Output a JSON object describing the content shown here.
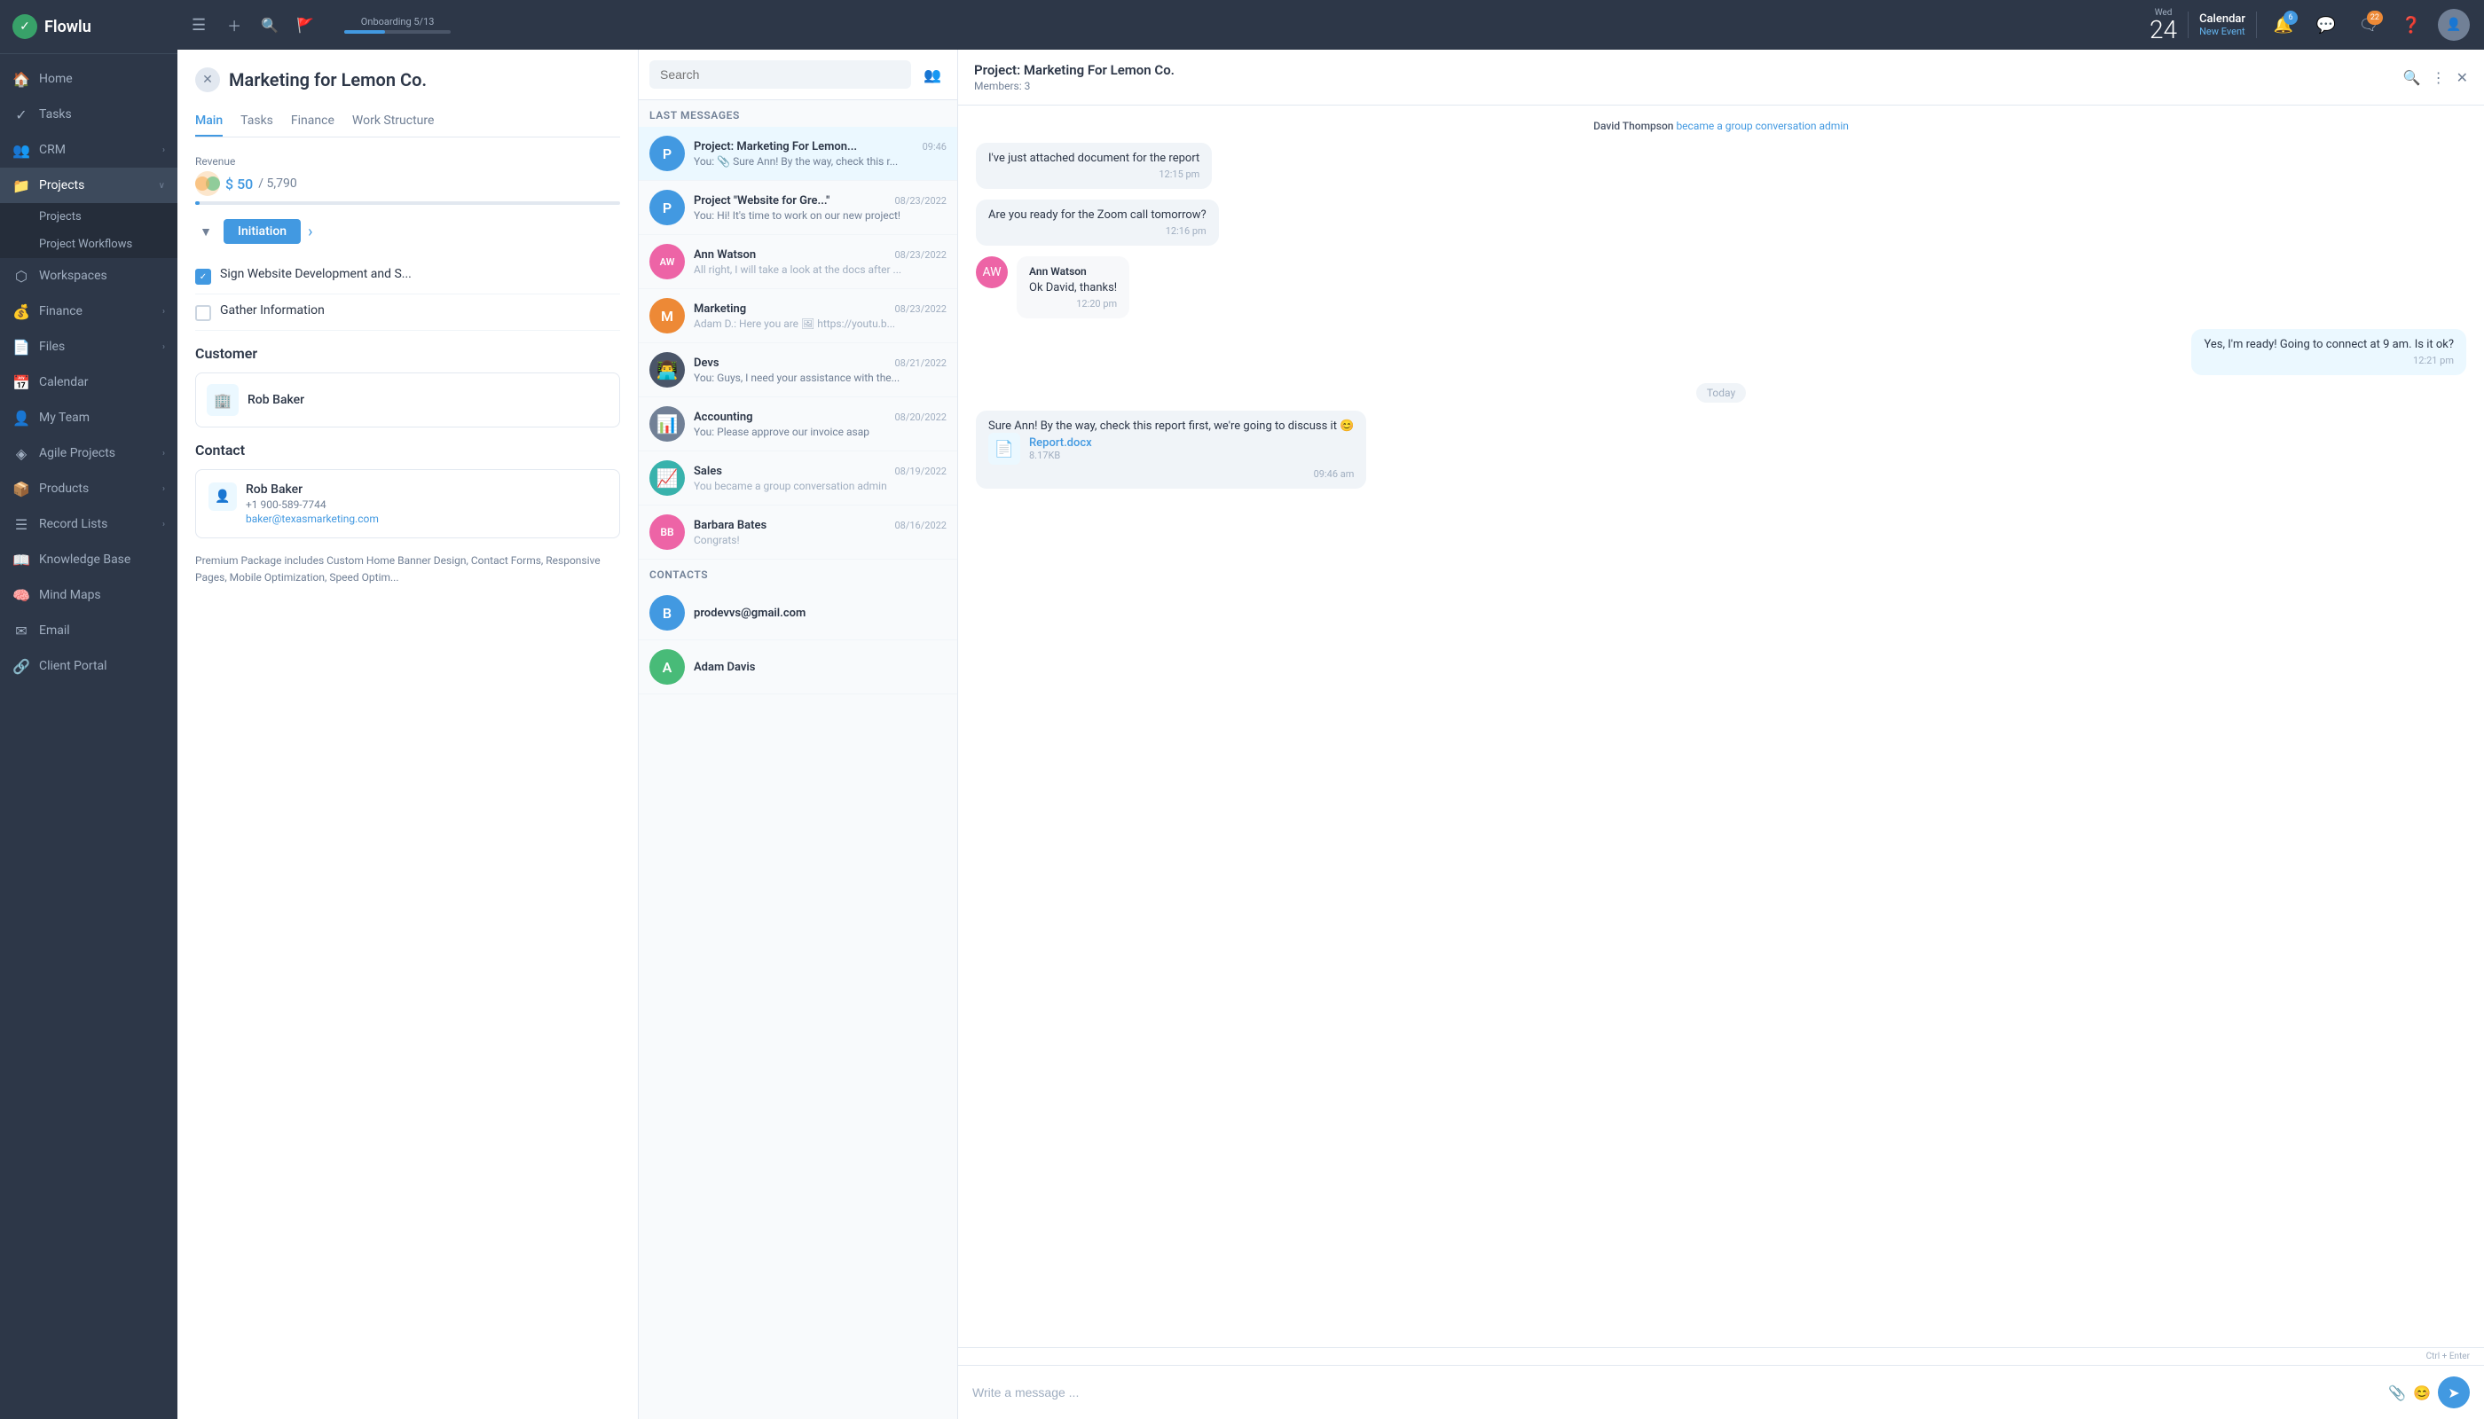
{
  "app": {
    "brand": "Flowlu",
    "topbar": {
      "onboarding_label": "Onboarding",
      "onboarding_progress": "5/13",
      "date_dow": "Wed",
      "date_day": "24",
      "calendar_label": "Calendar",
      "calendar_sub": "New Event",
      "bell_badge": "6",
      "chat_badge": "22"
    }
  },
  "sidebar": {
    "items": [
      {
        "id": "home",
        "label": "Home",
        "icon": "🏠",
        "hasChevron": false
      },
      {
        "id": "tasks",
        "label": "Tasks",
        "icon": "✓",
        "hasChevron": false
      },
      {
        "id": "crm",
        "label": "CRM",
        "icon": "👥",
        "hasChevron": true
      },
      {
        "id": "projects",
        "label": "Projects",
        "icon": "📁",
        "hasChevron": true,
        "active": true
      },
      {
        "id": "workspaces",
        "label": "Workspaces",
        "icon": "⬡",
        "hasChevron": false
      },
      {
        "id": "finance",
        "label": "Finance",
        "icon": "💰",
        "hasChevron": true
      },
      {
        "id": "files",
        "label": "Files",
        "icon": "📄",
        "hasChevron": true
      },
      {
        "id": "calendar",
        "label": "Calendar",
        "icon": "📅",
        "hasChevron": false
      },
      {
        "id": "my-team",
        "label": "My Team",
        "icon": "👤",
        "hasChevron": false
      },
      {
        "id": "agile",
        "label": "Agile Projects",
        "icon": "◈",
        "hasChevron": true
      },
      {
        "id": "products",
        "label": "Products",
        "icon": "📦",
        "hasChevron": true
      },
      {
        "id": "record-lists",
        "label": "Record Lists",
        "icon": "☰",
        "hasChevron": true
      },
      {
        "id": "knowledge-base",
        "label": "Knowledge Base",
        "icon": "📖",
        "hasChevron": false
      },
      {
        "id": "mind-maps",
        "label": "Mind Maps",
        "icon": "🧠",
        "hasChevron": false
      },
      {
        "id": "email",
        "label": "Email",
        "icon": "✉",
        "hasChevron": false
      },
      {
        "id": "client-portal",
        "label": "Client Portal",
        "icon": "🔗",
        "hasChevron": false
      }
    ],
    "sub_items": [
      {
        "id": "projects-sub",
        "label": "Projects",
        "active": false
      },
      {
        "id": "project-workflows",
        "label": "Project Workflows",
        "active": false
      }
    ]
  },
  "project": {
    "title": "Marketing for Lemon Co.",
    "close_label": "×",
    "tabs": [
      "Main",
      "Tasks",
      "Finance",
      "Work Structure"
    ],
    "active_tab": "Main",
    "revenue": {
      "label": "Revenue",
      "amount": "$ 50",
      "total": "/ 5,790"
    },
    "stage": "Initiation",
    "tasks": [
      {
        "id": "t1",
        "text": "Sign Website Development and S...",
        "checked": true
      },
      {
        "id": "t2",
        "text": "Gather Information",
        "checked": false
      }
    ],
    "customer": {
      "section_title": "Customer",
      "name": "Rob Baker"
    },
    "contact": {
      "section_title": "Contact",
      "name": "Rob Baker",
      "phone": "+1 900-589-7744",
      "email": "baker@texasmarketing.com"
    },
    "description": "Premium Package includes Custom Home Banner Design, Contact Forms, Responsive Pages, Mobile Optimization, Speed Optim..."
  },
  "messenger": {
    "search_placeholder": "Search",
    "last_messages_label": "Last messages",
    "messages": [
      {
        "id": "m1",
        "name": "Project: Marketing For Lemon...",
        "time": "09:46",
        "preview": "You: 📎 Sure Ann! By the way, check this r...",
        "avatar_color": "av-blue",
        "avatar_letter": "P",
        "active": true
      },
      {
        "id": "m2",
        "name": "Project \"Website for Gre...\"",
        "time": "08/23/2022",
        "preview": "You: Hi! It's time to work on our new project!",
        "avatar_color": "av-blue",
        "avatar_letter": "P",
        "active": false
      },
      {
        "id": "m3",
        "name": "Ann Watson",
        "time": "08/23/2022",
        "preview": "All right, I will take a look at the docs after ...",
        "avatar_color": "",
        "avatar_letter": "",
        "is_photo": true,
        "active": false
      },
      {
        "id": "m4",
        "name": "Marketing",
        "time": "08/23/2022",
        "preview": "Adam D.: Here you are 🖼 https://youtu.b...",
        "avatar_color": "av-orange",
        "avatar_letter": "M",
        "active": false
      },
      {
        "id": "m5",
        "name": "Devs",
        "time": "08/21/2022",
        "preview": "You: Guys, I need your assistance with the...",
        "avatar_color": "av-dark",
        "avatar_letter": "",
        "is_devs": true,
        "active": false
      },
      {
        "id": "m6",
        "name": "Accounting",
        "time": "08/20/2022",
        "preview": "You: Please approve our invoice asap",
        "avatar_color": "",
        "avatar_letter": "",
        "is_accounting": true,
        "active": false
      },
      {
        "id": "m7",
        "name": "Sales",
        "time": "08/19/2022",
        "preview": "You became a group conversation admin",
        "avatar_color": "",
        "avatar_letter": "",
        "is_sales": true,
        "active": false
      },
      {
        "id": "m8",
        "name": "Barbara Bates",
        "time": "08/16/2022",
        "preview": "Congrats!",
        "avatar_color": "av-pink",
        "avatar_letter": "",
        "is_barbara": true,
        "active": false
      }
    ],
    "contacts_label": "Contacts",
    "contacts": [
      {
        "id": "c1",
        "name": "prodevvs@gmail.com",
        "avatar_color": "av-blue",
        "avatar_letter": "B"
      },
      {
        "id": "c2",
        "name": "Adam Davis",
        "avatar_color": "av-green",
        "avatar_letter": "A"
      }
    ]
  },
  "chat": {
    "title": "Project: Marketing For Lemon Co.",
    "members": "Members: 3",
    "messages": [
      {
        "id": "cm1",
        "type": "admin",
        "admin_name": "David Thompson",
        "admin_action": "became a group conversation admin"
      },
      {
        "id": "cm2",
        "type": "bubble-left",
        "text": "I've just attached document for the report",
        "time": "12:15 pm"
      },
      {
        "id": "cm3",
        "type": "bubble-left",
        "text": "Are you ready for the Zoom call tomorrow?",
        "time": "12:16 pm"
      },
      {
        "id": "cm4",
        "type": "ann",
        "name": "Ann Watson",
        "text": "Ok David, thanks!",
        "time": "12:20 pm"
      },
      {
        "id": "cm5",
        "type": "bubble-right",
        "text": "Yes, I'm ready! Going to connect at 9 am. Is it ok?",
        "time": "12:21 pm"
      },
      {
        "id": "cm6",
        "type": "today"
      },
      {
        "id": "cm7",
        "type": "file-msg",
        "text": "Sure Ann! By the way, check this report first, we're going to discuss it 😊",
        "file_name": "Report.docx",
        "file_size": "8.17KB",
        "file_time": "09:46 am"
      }
    ],
    "input_placeholder": "Write a message ...",
    "send_hint": "Ctrl + Enter"
  }
}
